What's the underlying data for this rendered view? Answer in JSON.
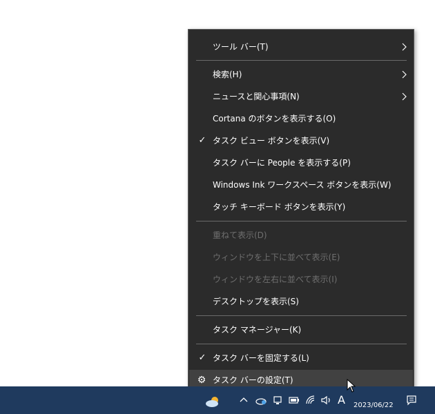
{
  "context_menu": {
    "items": [
      {
        "label": "ツール バー(T)",
        "submenu": true
      },
      {
        "label": "検索(H)",
        "submenu": true
      },
      {
        "label": "ニュースと関心事項(N)",
        "submenu": true
      },
      {
        "label": "Cortana のボタンを表示する(O)"
      },
      {
        "label": "タスク ビュー ボタンを表示(V)",
        "checked": true
      },
      {
        "label": "タスク バーに People を表示する(P)"
      },
      {
        "label": "Windows Ink ワークスペース ボタンを表示(W)"
      },
      {
        "label": "タッチ キーボード ボタンを表示(Y)"
      },
      {
        "label": "重ねて表示(D)",
        "disabled": true
      },
      {
        "label": "ウィンドウを上下に並べて表示(E)",
        "disabled": true
      },
      {
        "label": "ウィンドウを左右に並べて表示(I)",
        "disabled": true
      },
      {
        "label": "デスクトップを表示(S)"
      },
      {
        "label": "タスク マネージャー(K)"
      },
      {
        "label": "タスク バーを固定する(L)",
        "checked": true
      },
      {
        "label": "タスク バーの設定(T)",
        "icon": "gear-icon",
        "highlighted": true
      }
    ],
    "check_glyph": "✓",
    "gear_glyph": "⚙"
  },
  "taskbar": {
    "date": "2023/06/22",
    "ime_indicator": "A",
    "tray_icons": [
      "weather-icon",
      "chevron-up-icon",
      "network-icon",
      "battery-icon",
      "volume-icon",
      "notification-icon"
    ]
  },
  "colors": {
    "menu_bg": "#2b2b2b",
    "menu_hover": "#414141",
    "menu_text": "#ffffff",
    "menu_disabled": "#6f6f6f",
    "taskbar_bg": "#1f3a5e"
  }
}
